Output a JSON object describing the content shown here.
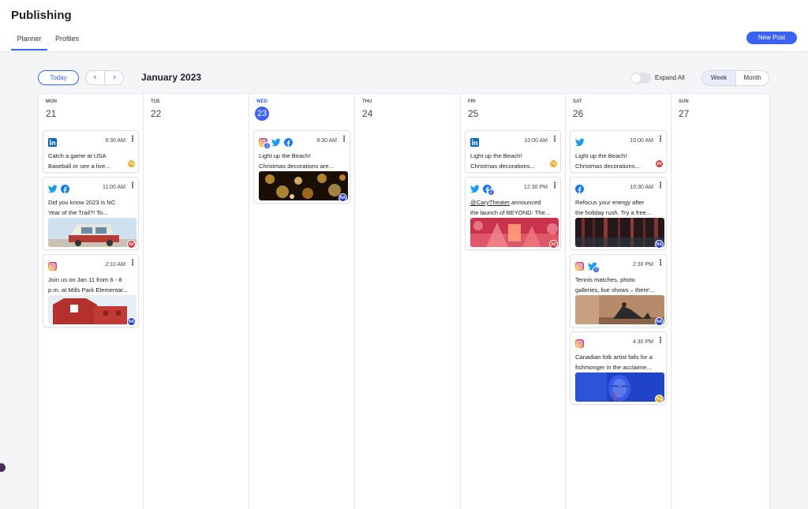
{
  "app": {
    "title": "Publishing"
  },
  "tabs": [
    {
      "label": "Planner"
    },
    {
      "label": "Profiles"
    }
  ],
  "header": {
    "new_post_label": "New Post"
  },
  "toolbar": {
    "today_label": "Today",
    "prev_glyph": "‹",
    "next_glyph": "›",
    "month_label": "January 2023",
    "expand_all_label": "Expand All",
    "views": [
      {
        "label": "Week",
        "selected": true
      },
      {
        "label": "Month",
        "selected": false
      }
    ]
  },
  "colors": {
    "accent": "#3a63f2",
    "linkedin": "#0a66c2",
    "twitter": "#1d9bf0",
    "facebook": "#1877f2",
    "instagram": "#d62976",
    "avatar_yg": "#f0a91e",
    "avatar_av": "#d93a3a",
    "avatar_na": "#1f3bd1"
  },
  "days": [
    {
      "dow": "MON",
      "num": "21",
      "today": false
    },
    {
      "dow": "TUE",
      "num": "22",
      "today": false
    },
    {
      "dow": "WED",
      "num": "23",
      "today": true
    },
    {
      "dow": "THU",
      "num": "24",
      "today": false
    },
    {
      "dow": "FRI",
      "num": "25",
      "today": false
    },
    {
      "dow": "SAT",
      "num": "26",
      "today": false
    },
    {
      "dow": "SUN",
      "num": "27",
      "today": false
    }
  ],
  "posts": [
    {
      "day": 0,
      "networks": [
        "linkedin"
      ],
      "time": "9:30 AM",
      "line1": "Catch a game at USA",
      "line2": "Baseball or see a live...",
      "image": "",
      "avatar": "YG"
    },
    {
      "day": 0,
      "networks": [
        "twitter",
        "facebook"
      ],
      "time": "11:00 AM",
      "line1": "Did you know 2023 is NC",
      "line2": "Year of the Trail?! To...",
      "image": "van",
      "avatar": "AV"
    },
    {
      "day": 0,
      "networks": [
        "instagram"
      ],
      "time": "2:10 AM",
      "line1": "Join us on Jan 11 from 6 - 8",
      "line2": "p.m. at Mills Park Elementar...",
      "image": "barn",
      "avatar": "NA"
    },
    {
      "day": 2,
      "networks": [
        "instagram",
        "twitter",
        "facebook"
      ],
      "count": "2",
      "time": "9:30 AM",
      "line1": "Light up the Beach!",
      "line2": "Christmas decorations are...",
      "image": "bokeh",
      "avatar": "NA"
    },
    {
      "day": 4,
      "networks": [
        "linkedin"
      ],
      "time": "10:00 AM",
      "line1": "Light up the Beach!",
      "line2": "Christmas decorations...",
      "image": "",
      "avatar": "YG"
    },
    {
      "day": 4,
      "networks": [
        "twitter",
        "facebook"
      ],
      "count": "2",
      "time": "12:30 PM",
      "mention": "@CaryTheater",
      "line1": " announced",
      "line2": "the launch of BEYOND: The...",
      "image": "theater",
      "avatar": "AV"
    },
    {
      "day": 5,
      "networks": [
        "twitter"
      ],
      "time": "10:00 AM",
      "line1": "Light up the Beach!",
      "line2": "Christmas decorations...",
      "image": "",
      "avatar": "AV"
    },
    {
      "day": 5,
      "networks": [
        "facebook"
      ],
      "time": "10:30 AM",
      "line1": "Refocus your energy after",
      "line2": "the holiday rush. Try a free...",
      "image": "forest",
      "avatar": "NA"
    },
    {
      "day": 5,
      "networks": [
        "instagram",
        "twitter"
      ],
      "count": "3",
      "time": "2:30 PM",
      "line1": "Tennis matches, photo",
      "line2": "galleries, live shows – there'...",
      "image": "yoga",
      "avatar": "NA"
    },
    {
      "day": 5,
      "networks": [
        "instagram"
      ],
      "time": "4:30 PM",
      "line1": "Canadian folk artist falls for a",
      "line2": "fishmonger in the acclaime...",
      "image": "face",
      "avatar": "YG"
    }
  ]
}
